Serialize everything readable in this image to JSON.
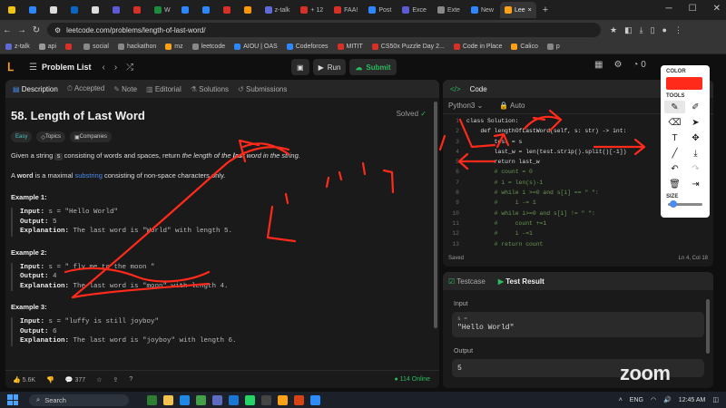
{
  "browser": {
    "tabs": [
      {
        "label": "",
        "color": "#f1c40f"
      },
      {
        "label": "",
        "color": "#2d88ff"
      },
      {
        "label": "",
        "color": "#dddddd"
      },
      {
        "label": "",
        "color": "#0a66c2"
      },
      {
        "label": "",
        "color": "#dddddd"
      },
      {
        "label": "",
        "color": "#5b5bd6"
      },
      {
        "label": "",
        "color": "#d93025"
      },
      {
        "label": "W",
        "color": "#1a8d3a"
      },
      {
        "label": "",
        "color": "#2d88ff"
      },
      {
        "label": "",
        "color": "#2d88ff"
      },
      {
        "label": "",
        "color": "#d93025"
      },
      {
        "label": "",
        "color": "#ff9800"
      },
      {
        "label": "z-talk",
        "color": "#5f6ad6"
      },
      {
        "label": "+ 12",
        "color": "#d93025"
      },
      {
        "label": "FAA!",
        "color": "#d93025"
      },
      {
        "label": "Post",
        "color": "#2d88ff"
      },
      {
        "label": "Exce",
        "color": "#5b5bd6"
      },
      {
        "label": "Exte",
        "color": "#888888"
      },
      {
        "label": "New",
        "color": "#2d88ff"
      },
      {
        "label": "Lee",
        "color": "#ffa116",
        "active": true
      }
    ],
    "url": "leetcode.com/problems/length-of-last-word/",
    "bookmarks": [
      {
        "label": "z-talk",
        "color": "#5f6ad6"
      },
      {
        "label": "api",
        "color": "#999999"
      },
      {
        "label": "",
        "color": "#d93025"
      },
      {
        "label": "social",
        "color": "#888888"
      },
      {
        "label": "hackathon",
        "color": "#888888"
      },
      {
        "label": "mz",
        "color": "#ffa116"
      },
      {
        "label": "leetcode",
        "color": "#888888"
      },
      {
        "label": "AIOU | OAS",
        "color": "#2d88ff"
      },
      {
        "label": "Codeforces",
        "color": "#2d88ff"
      },
      {
        "label": "MITIT",
        "color": "#d93025"
      },
      {
        "label": "CS50x Puzzle Day 2...",
        "color": "#d93025"
      },
      {
        "label": "Code in Place",
        "color": "#d93025"
      },
      {
        "label": "Calico",
        "color": "#ffa116"
      },
      {
        "label": "p",
        "color": "#888888"
      }
    ]
  },
  "lc": {
    "problem_list": "Problem List",
    "run": "Run",
    "submit": "Submit",
    "streak": "0"
  },
  "desc": {
    "tabs": [
      "Description",
      "Accepted",
      "Note",
      "Editorial",
      "Solutions",
      "Submissions"
    ],
    "title": "58. Length of Last Word",
    "solved": "Solved",
    "chips": [
      "Easy",
      "Topics",
      "Companies"
    ],
    "para1_a": "Given a string ",
    "para1_code": "s",
    "para1_b": " consisting of words and spaces, return ",
    "para1_c": "the length of the ",
    "para1_d": "last",
    "para1_e": " word in the string.",
    "para2_a": "A ",
    "para2_b": "word",
    "para2_c": " is a maximal ",
    "para2_d": "substring",
    "para2_e": " consisting of non-space characters only.",
    "examples": [
      {
        "h": "Example 1:",
        "input": "s = \"Hello World\"",
        "output": "5",
        "explanation": "The last word is \"World\" with length 5."
      },
      {
        "h": "Example 2:",
        "input": "s = \"   fly me   to   the moon  \"",
        "output": "4",
        "explanation": "The last word is \"moon\" with length 4."
      },
      {
        "h": "Example 3:",
        "input": "s = \"luffy is still joyboy\"",
        "output": "6",
        "explanation": "The last word is \"joyboy\" with length 6."
      }
    ],
    "input_label": "Input:",
    "output_label": "Output:",
    "expl_label": "Explanation:",
    "likes": "5.6K",
    "comments": "377",
    "online": "114 Online"
  },
  "code": {
    "title": "Code",
    "language": "Python3",
    "auto": "Auto",
    "lines": [
      "class Solution:",
      "    def lengthOfLastWord(self, s: str) -> int:",
      "        test = s",
      "        last_w = len(test.strip().split()[-1])",
      "        return last_w",
      "        # count = 0",
      "        # i = len(s)-1",
      "        # while i >=0 and s[i] == \" \":",
      "        #     i -= 1",
      "        # while i>=0 and s[i] != \" \":",
      "        #     count +=1",
      "        #     i -=1",
      "        # return count"
    ],
    "saved": "Saved",
    "position": "Ln 4, Col 18"
  },
  "test": {
    "tabs": [
      "Testcase",
      "Test Result"
    ],
    "input_label": "Input",
    "var": "s =",
    "input_value": "\"Hello World\"",
    "output_label": "Output",
    "output_value": "5"
  },
  "annotate": {
    "color_label": "COLOR",
    "tools_label": "TOOLS",
    "size_label": "SIZE",
    "color": "#ff2a1a",
    "size_level": 0.15
  },
  "taskbar": {
    "search": "Search",
    "time": "12:45 AM",
    "lang": "ENG"
  },
  "watermark": "zoom"
}
